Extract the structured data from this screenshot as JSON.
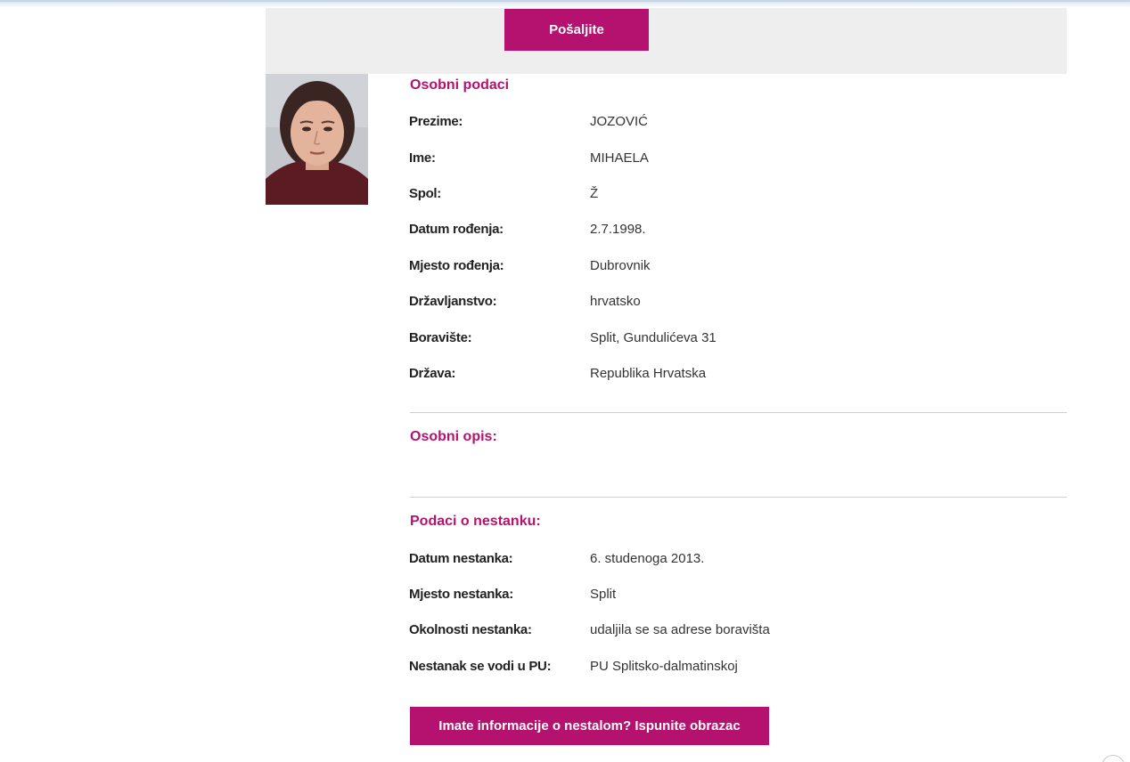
{
  "header": {
    "send_label": "Pošaljite"
  },
  "profile": {
    "section_title": "Osobni podaci",
    "fields": [
      {
        "label": "Prezime:",
        "value": "JOZOVIĆ"
      },
      {
        "label": "Ime:",
        "value": "MIHAELA"
      },
      {
        "label": "Spol:",
        "value": "Ž"
      },
      {
        "label": "Datum rođenja:",
        "value": "2.7.1998."
      },
      {
        "label": "Mjesto rođenja:",
        "value": "Dubrovnik"
      },
      {
        "label": "Državljanstvo:",
        "value": "hrvatsko"
      },
      {
        "label": "Boravište:",
        "value": "Split, Gundulićeva 31"
      },
      {
        "label": "Država:",
        "value": "Republika Hrvatska"
      }
    ]
  },
  "description": {
    "section_title": "Osobni opis:"
  },
  "disappearance": {
    "section_title": "Podaci o nestanku:",
    "fields": [
      {
        "label": "Datum nestanka:",
        "value": "6. studenoga 2013."
      },
      {
        "label": "Mjesto nestanka:",
        "value": "Split"
      },
      {
        "label": "Okolnosti nestanka:",
        "value": "udaljila se sa adrese boravišta"
      },
      {
        "label": "Nestanak se vodi u PU:",
        "value": "PU Splitsko-dalmatinskoj"
      }
    ]
  },
  "footer": {
    "info_button_label": "Imate informacije o nestalom? Ispunite obrazac"
  },
  "colors": {
    "accent": "#b5126f",
    "bar_gray": "#eeeeee"
  }
}
